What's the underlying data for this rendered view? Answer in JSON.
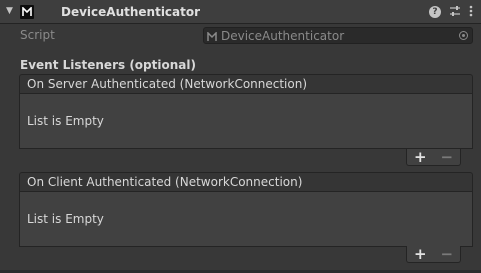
{
  "header": {
    "title": "DeviceAuthenticator",
    "foldout_icon": "triangle-down",
    "logo_icon": "mirror-logo",
    "help_label": "?",
    "presets_icon": "sliders-icon",
    "menu_icon": "kebab-menu"
  },
  "script": {
    "label": "Script",
    "value": "DeviceAuthenticator"
  },
  "events": {
    "title": "Event Listeners (optional)",
    "server": {
      "header": "On Server Authenticated (NetworkConnection)",
      "empty_text": "List is Empty",
      "add_label": "+",
      "remove_label": "−"
    },
    "client": {
      "header": "On Client Authenticated (NetworkConnection)",
      "empty_text": "List is Empty",
      "add_label": "+",
      "remove_label": "−"
    }
  },
  "colors": {
    "background": "#383838",
    "header": "#3e3e3e",
    "field": "#2a2a2a",
    "text": "#d2d2d2",
    "muted": "#8a8a8a"
  }
}
